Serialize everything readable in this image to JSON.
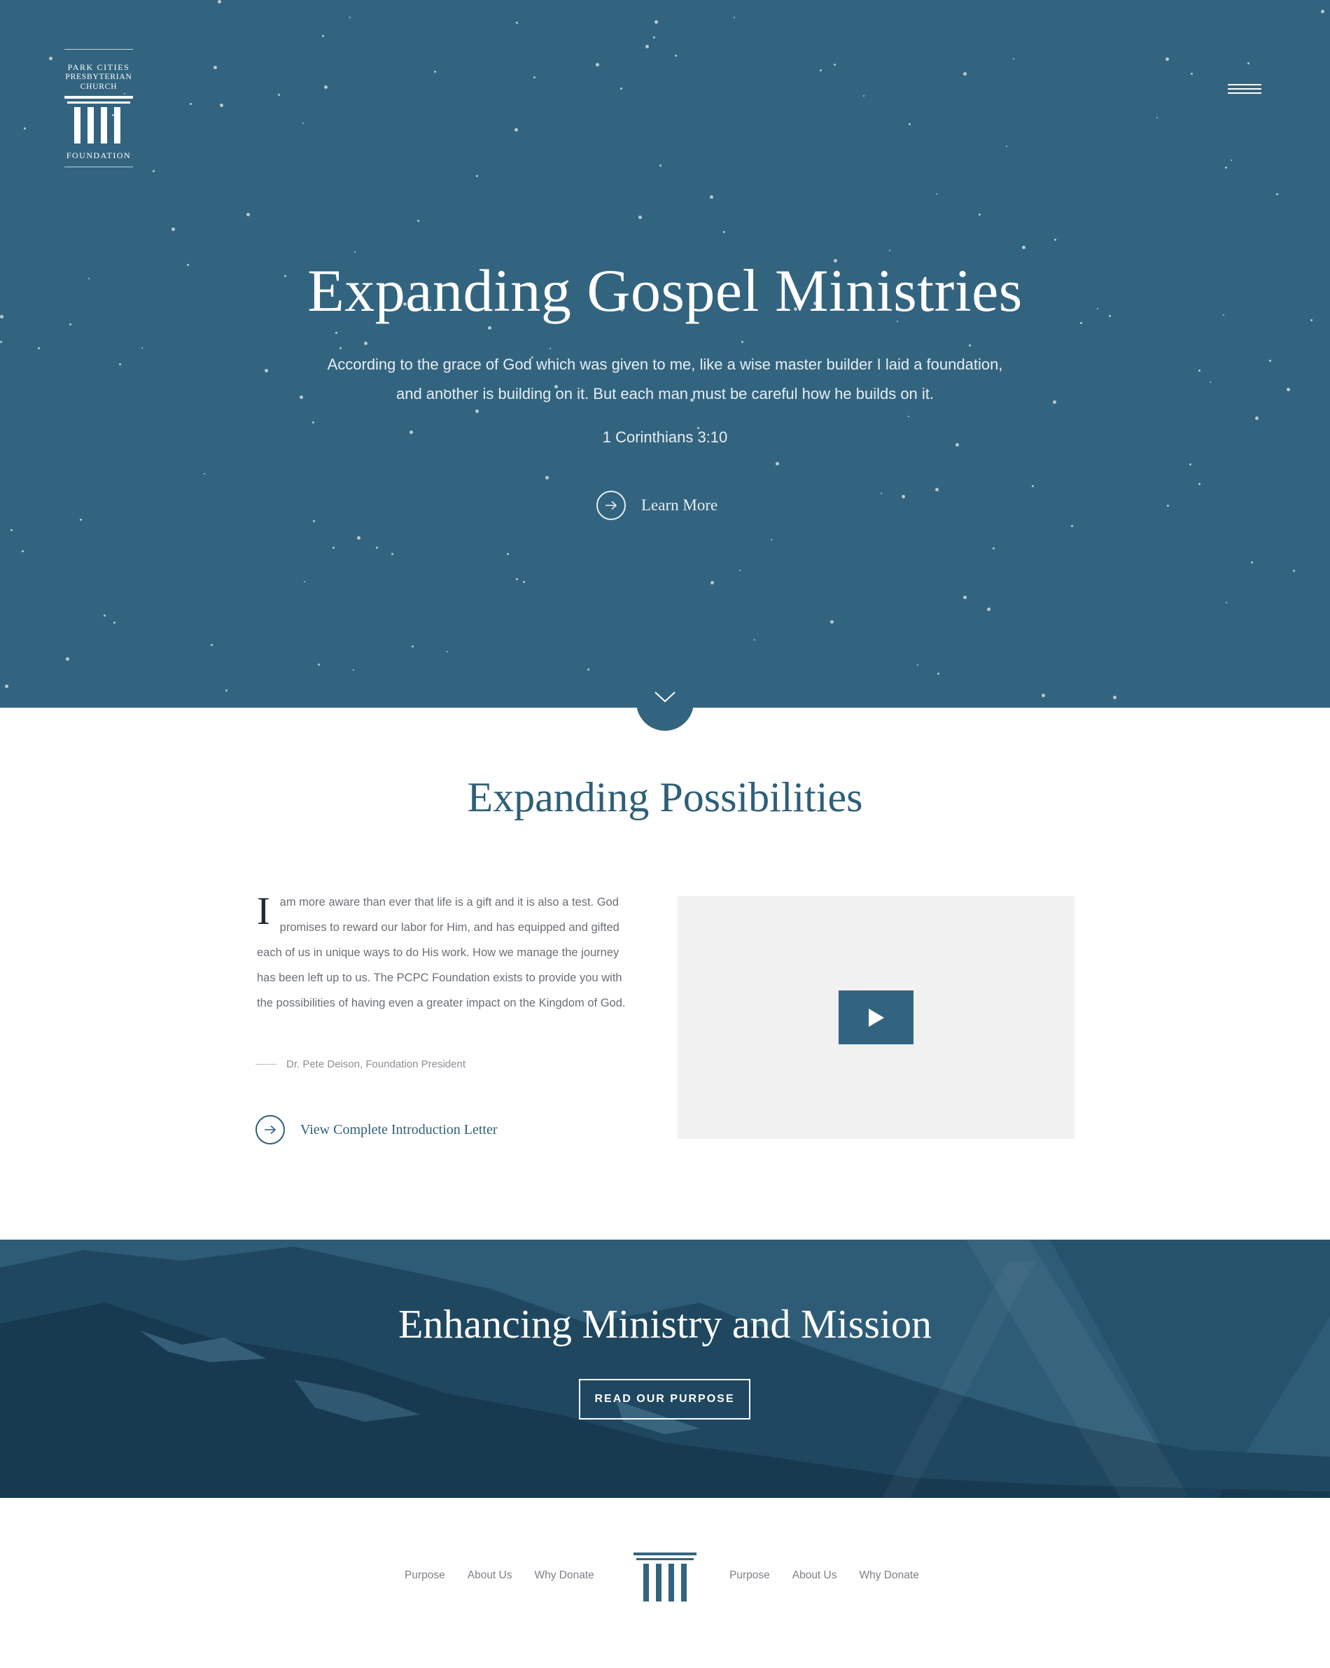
{
  "logo": {
    "line1": "PARK CITIES",
    "line2": "PRESBYTERIAN",
    "line3": "CHURCH",
    "line4": "FOUNDATION"
  },
  "header": {
    "menu_icon": "hamburger-menu-icon"
  },
  "hero": {
    "title": "Expanding Gospel Ministries",
    "quote_line1": "According to the grace of God which was given to me, like a wise master builder I laid a foundation,",
    "quote_line2": "and another is building on it. But each man must be careful how he builds on it.",
    "citation": "1 Corinthians 3:10",
    "cta_label": "Learn More",
    "cta_icon": "arrow-right-circle-icon",
    "scroll_icon": "chevron-down-icon"
  },
  "possibilities": {
    "title": "Expanding Possibilities",
    "dropcap": "I",
    "body": "am more aware than ever that life is a gift and it is also a test. God promises to reward our labor for Him, and has equipped and gifted each of us in unique ways to do His work. How we manage the journey has been left up to us. The PCPC Foundation exists to provide you with the possibilities of having even a greater impact on the Kingdom of God.",
    "signature": "Dr. Pete Deison, Foundation President",
    "link_label": "View Complete Introduction Letter",
    "video_icon": "play-icon"
  },
  "banner": {
    "title": "Enhancing Ministry and Mission",
    "button_label": "READ OUR PURPOSE"
  },
  "footer": {
    "left_links": [
      "Purpose",
      "About Us",
      "Why Donate"
    ],
    "right_links": [
      "Purpose",
      "About Us",
      "Why Donate"
    ]
  },
  "colors": {
    "brand": "#33647f",
    "heading": "#2f5f79",
    "body_text": "#6a6f76",
    "video_bg": "#f1f1f1"
  }
}
